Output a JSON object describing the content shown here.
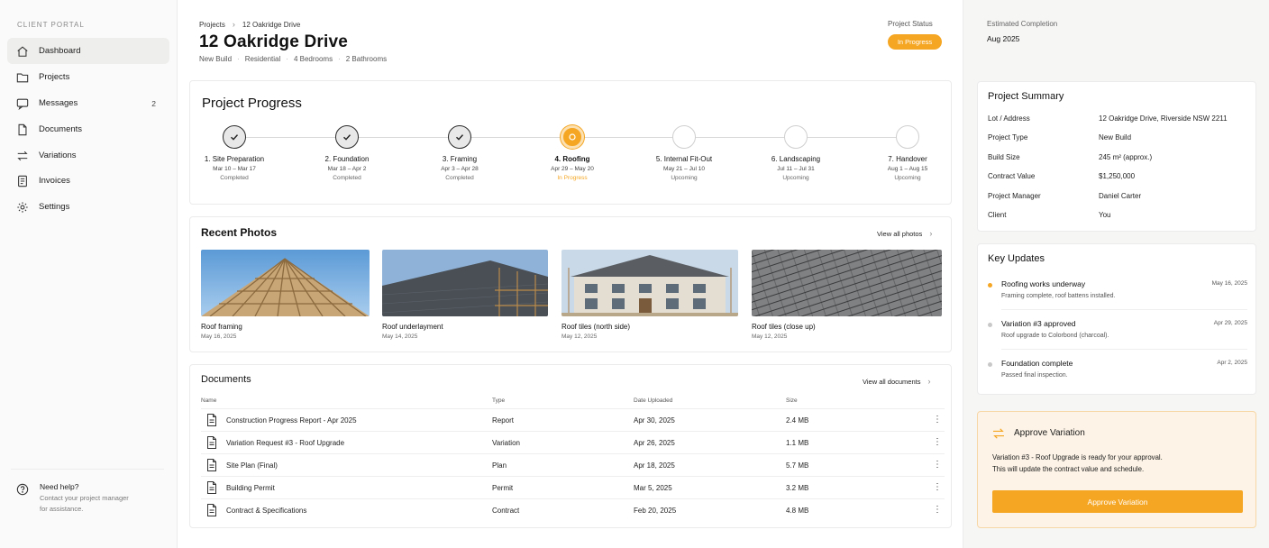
{
  "sidebar": {
    "portal_label": "CLIENT PORTAL",
    "items": [
      {
        "label": "Dashboard",
        "icon": "home-icon",
        "active": true
      },
      {
        "label": "Projects",
        "icon": "folder-icon"
      },
      {
        "label": "Messages",
        "icon": "message-icon",
        "badge": "2"
      },
      {
        "label": "Documents",
        "icon": "document-icon"
      },
      {
        "label": "Variations",
        "icon": "swap-arrows-icon"
      },
      {
        "label": "Invoices",
        "icon": "receipt-icon"
      },
      {
        "label": "Settings",
        "icon": "gear-icon"
      }
    ],
    "help": {
      "title": "Need help?",
      "text_line1": "Contact your project manager",
      "text_line2": "for assistance."
    }
  },
  "header": {
    "breadcrumb": [
      "Projects",
      "12 Oakridge Drive"
    ],
    "title": "12 Oakridge Drive",
    "meta": [
      "New Build",
      "Residential",
      "4 Bedrooms",
      "2 Bathrooms"
    ],
    "status_label": "Project Status",
    "status": "In Progress"
  },
  "progress": {
    "title": "Project Progress",
    "steps": [
      {
        "title": "1. Site Preparation",
        "dates": "Mar 10 – Mar 17",
        "status": "Completed",
        "state": "done"
      },
      {
        "title": "2. Foundation",
        "dates": "Mar 18 – Apr 2",
        "status": "Completed",
        "state": "done"
      },
      {
        "title": "3. Framing",
        "dates": "Apr 3 – Apr 28",
        "status": "Completed",
        "state": "done"
      },
      {
        "title": "4. Roofing",
        "dates": "Apr 29 – May 20",
        "status": "In Progress",
        "state": "current"
      },
      {
        "title": "5. Internal Fit-Out",
        "dates": "May 21 – Jul 10",
        "status": "Upcoming",
        "state": "upcoming"
      },
      {
        "title": "6. Landscaping",
        "dates": "Jul 11 – Jul 31",
        "status": "Upcoming",
        "state": "upcoming"
      },
      {
        "title": "7. Handover",
        "dates": "Aug 1 – Aug 15",
        "status": "Upcoming",
        "state": "upcoming"
      }
    ]
  },
  "photos": {
    "title": "Recent Photos",
    "view_all": "View all photos",
    "items": [
      {
        "name": "Roof framing",
        "date": "May 16, 2025"
      },
      {
        "name": "Roof underlayment",
        "date": "May 14, 2025"
      },
      {
        "name": "Roof tiles (north side)",
        "date": "May 12, 2025"
      },
      {
        "name": "Roof tiles (close up)",
        "date": "May 12, 2025"
      }
    ]
  },
  "documents": {
    "title": "Documents",
    "view_all": "View all documents",
    "columns": [
      "Name",
      "Type",
      "Date Uploaded",
      "Size"
    ],
    "rows": [
      {
        "name": "Construction Progress Report - Apr 2025",
        "type": "Report",
        "date": "Apr 30, 2025",
        "size": "2.4 MB"
      },
      {
        "name": "Variation Request #3 - Roof Upgrade",
        "type": "Variation",
        "date": "Apr 26, 2025",
        "size": "1.1 MB"
      },
      {
        "name": "Site Plan (Final)",
        "type": "Plan",
        "date": "Apr 18, 2025",
        "size": "5.7 MB"
      },
      {
        "name": "Building Permit",
        "type": "Permit",
        "date": "Mar 5, 2025",
        "size": "3.2 MB"
      },
      {
        "name": "Contract & Specifications",
        "type": "Contract",
        "date": "Feb 20, 2025",
        "size": "4.8 MB"
      }
    ]
  },
  "right": {
    "est_label": "Estimated Completion",
    "est_value": "Aug 2025",
    "summary": {
      "title": "Project Summary",
      "rows": [
        {
          "k": "Lot / Address",
          "v": "12 Oakridge Drive, Riverside NSW 2211"
        },
        {
          "k": "Project Type",
          "v": "New Build"
        },
        {
          "k": "Build Size",
          "v": "245 m² (approx.)"
        },
        {
          "k": "Contract Value",
          "v": "$1,250,000"
        },
        {
          "k": "Project Manager",
          "v": "Daniel Carter"
        },
        {
          "k": "Client",
          "v": "You"
        }
      ]
    },
    "updates": {
      "title": "Key Updates",
      "items": [
        {
          "title": "Roofing works underway",
          "desc": "Framing complete, roof battens installed.",
          "date": "May 16, 2025",
          "color": "#f5a623"
        },
        {
          "title": "Variation #3 approved",
          "desc": "Roof upgrade to Colorbond (charcoal).",
          "date": "Apr 29, 2025",
          "color": "#c8c8c8"
        },
        {
          "title": "Foundation complete",
          "desc": "Passed final inspection.",
          "date": "Apr 2, 2025",
          "color": "#c8c8c8"
        }
      ]
    },
    "approve": {
      "title": "Approve Variation",
      "text_line1": "Variation #3 - Roof Upgrade is ready for your approval.",
      "text_line2": "This will update the contract value and schedule.",
      "button": "Approve Variation"
    }
  },
  "colors": {
    "accent": "#f5a623",
    "accent_soft": "#fdf3e6"
  }
}
